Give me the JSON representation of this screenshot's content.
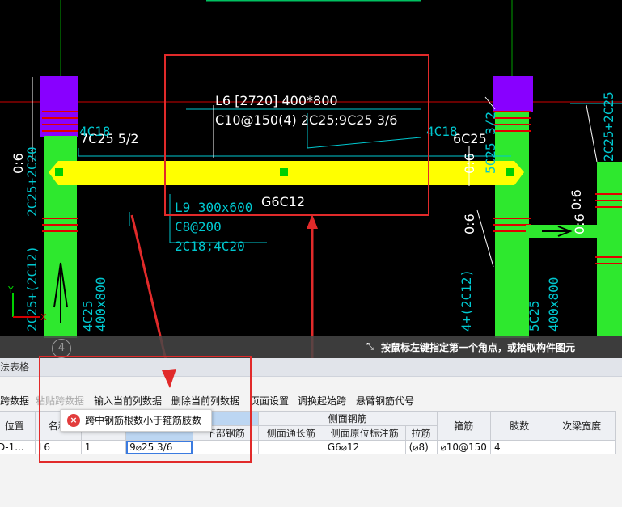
{
  "cad": {
    "beam_label_line1": "L6 [2720] 400*800",
    "beam_label_line2": "C10@150(4) 2C25;9C25 3/6",
    "left_beam_text": "7C25 5/2",
    "right_beam_text": "6C25",
    "side_bar_text": "G6C12",
    "sub_beam_label": "L9  300x600",
    "sub_beam_line2": "C8@200",
    "sub_beam_line3": "2C18;4C20",
    "c18_top": "4C18",
    "c18_right": "4C18",
    "left_col_vert": "2C25+2C20",
    "left_col_06": "0:6",
    "right_col_06a": "0:6",
    "right_col_06b": "0:6",
    "right_col_06c": "0:6",
    "far_right_vert": "5C25 3/2",
    "far_right_vert2": "2C25+2C25",
    "bottom_col_a": "4C25",
    "bottom_col_b": "400x800",
    "bottom_col_c": "5C25",
    "bottom_col_d": "400x800",
    "bottom_col_e": "2C25+(2C12)",
    "bottom_col_f": "4+(2C12)",
    "far_right_06": "0:6",
    "colors": {
      "beam": "#ffff00",
      "column": "#2ee82e",
      "column_top": "#8800ff",
      "rebar": "#e00000",
      "annotation": "#e12a2a"
    }
  },
  "hint": {
    "text": "按鼠标左键指定第一个角点，或拾取构件图元",
    "icon": "cursor-corner-icon",
    "badge": "4"
  },
  "panel": {
    "title": "法表格",
    "toolbar": [
      {
        "label": "跨数据",
        "disabled": false
      },
      {
        "label": "粘贴跨数据",
        "disabled": true
      },
      {
        "label": "输入当前列数据",
        "disabled": false
      },
      {
        "label": "删除当前列数据",
        "disabled": false
      },
      {
        "label": "页面设置",
        "disabled": false
      },
      {
        "label": "调换起始跨",
        "disabled": false
      },
      {
        "label": "悬臂钢筋代号",
        "disabled": false
      }
    ],
    "headers": {
      "position": "位置",
      "name": "名称",
      "span": "跨号",
      "top_rebar": "上部钢筋",
      "bottom_rebar": "下部钢筋",
      "side_group": "侧面钢筋",
      "side_through": "侧面通长筋",
      "side_original": "侧面原位标注筋",
      "tie": "拉筋",
      "stirrup": "箍筋",
      "legs": "肢数",
      "sub_beam_width": "次梁宽度"
    },
    "row": {
      "position": "D-1...",
      "name": "L6",
      "span": "1",
      "top_rebar": "9⌀25 3/6",
      "bottom_rebar": "",
      "side_through": "",
      "side_original": "G6⌀12",
      "tie": "(⌀8)",
      "stirrup": "⌀10@150",
      "legs": "4",
      "sub_beam_width": ""
    }
  },
  "tooltip": {
    "icon": "error-icon",
    "message": "跨中钢筋根数小于箍筋肢数"
  }
}
